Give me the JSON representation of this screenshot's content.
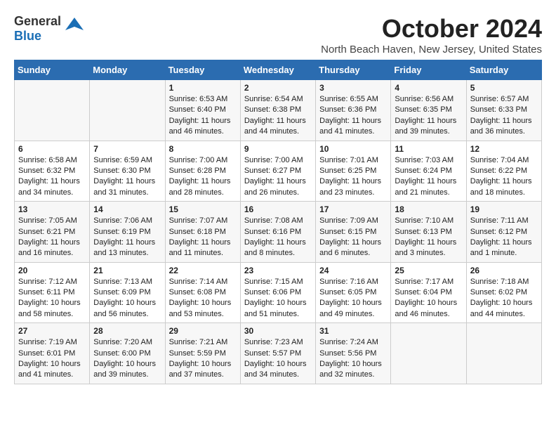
{
  "header": {
    "logo_general": "General",
    "logo_blue": "Blue",
    "month": "October 2024",
    "location": "North Beach Haven, New Jersey, United States"
  },
  "weekdays": [
    "Sunday",
    "Monday",
    "Tuesday",
    "Wednesday",
    "Thursday",
    "Friday",
    "Saturday"
  ],
  "weeks": [
    [
      {
        "day": "",
        "content": ""
      },
      {
        "day": "",
        "content": ""
      },
      {
        "day": "1",
        "content": "Sunrise: 6:53 AM\nSunset: 6:40 PM\nDaylight: 11 hours and 46 minutes."
      },
      {
        "day": "2",
        "content": "Sunrise: 6:54 AM\nSunset: 6:38 PM\nDaylight: 11 hours and 44 minutes."
      },
      {
        "day": "3",
        "content": "Sunrise: 6:55 AM\nSunset: 6:36 PM\nDaylight: 11 hours and 41 minutes."
      },
      {
        "day": "4",
        "content": "Sunrise: 6:56 AM\nSunset: 6:35 PM\nDaylight: 11 hours and 39 minutes."
      },
      {
        "day": "5",
        "content": "Sunrise: 6:57 AM\nSunset: 6:33 PM\nDaylight: 11 hours and 36 minutes."
      }
    ],
    [
      {
        "day": "6",
        "content": "Sunrise: 6:58 AM\nSunset: 6:32 PM\nDaylight: 11 hours and 34 minutes."
      },
      {
        "day": "7",
        "content": "Sunrise: 6:59 AM\nSunset: 6:30 PM\nDaylight: 11 hours and 31 minutes."
      },
      {
        "day": "8",
        "content": "Sunrise: 7:00 AM\nSunset: 6:28 PM\nDaylight: 11 hours and 28 minutes."
      },
      {
        "day": "9",
        "content": "Sunrise: 7:00 AM\nSunset: 6:27 PM\nDaylight: 11 hours and 26 minutes."
      },
      {
        "day": "10",
        "content": "Sunrise: 7:01 AM\nSunset: 6:25 PM\nDaylight: 11 hours and 23 minutes."
      },
      {
        "day": "11",
        "content": "Sunrise: 7:03 AM\nSunset: 6:24 PM\nDaylight: 11 hours and 21 minutes."
      },
      {
        "day": "12",
        "content": "Sunrise: 7:04 AM\nSunset: 6:22 PM\nDaylight: 11 hours and 18 minutes."
      }
    ],
    [
      {
        "day": "13",
        "content": "Sunrise: 7:05 AM\nSunset: 6:21 PM\nDaylight: 11 hours and 16 minutes."
      },
      {
        "day": "14",
        "content": "Sunrise: 7:06 AM\nSunset: 6:19 PM\nDaylight: 11 hours and 13 minutes."
      },
      {
        "day": "15",
        "content": "Sunrise: 7:07 AM\nSunset: 6:18 PM\nDaylight: 11 hours and 11 minutes."
      },
      {
        "day": "16",
        "content": "Sunrise: 7:08 AM\nSunset: 6:16 PM\nDaylight: 11 hours and 8 minutes."
      },
      {
        "day": "17",
        "content": "Sunrise: 7:09 AM\nSunset: 6:15 PM\nDaylight: 11 hours and 6 minutes."
      },
      {
        "day": "18",
        "content": "Sunrise: 7:10 AM\nSunset: 6:13 PM\nDaylight: 11 hours and 3 minutes."
      },
      {
        "day": "19",
        "content": "Sunrise: 7:11 AM\nSunset: 6:12 PM\nDaylight: 11 hours and 1 minute."
      }
    ],
    [
      {
        "day": "20",
        "content": "Sunrise: 7:12 AM\nSunset: 6:11 PM\nDaylight: 10 hours and 58 minutes."
      },
      {
        "day": "21",
        "content": "Sunrise: 7:13 AM\nSunset: 6:09 PM\nDaylight: 10 hours and 56 minutes."
      },
      {
        "day": "22",
        "content": "Sunrise: 7:14 AM\nSunset: 6:08 PM\nDaylight: 10 hours and 53 minutes."
      },
      {
        "day": "23",
        "content": "Sunrise: 7:15 AM\nSunset: 6:06 PM\nDaylight: 10 hours and 51 minutes."
      },
      {
        "day": "24",
        "content": "Sunrise: 7:16 AM\nSunset: 6:05 PM\nDaylight: 10 hours and 49 minutes."
      },
      {
        "day": "25",
        "content": "Sunrise: 7:17 AM\nSunset: 6:04 PM\nDaylight: 10 hours and 46 minutes."
      },
      {
        "day": "26",
        "content": "Sunrise: 7:18 AM\nSunset: 6:02 PM\nDaylight: 10 hours and 44 minutes."
      }
    ],
    [
      {
        "day": "27",
        "content": "Sunrise: 7:19 AM\nSunset: 6:01 PM\nDaylight: 10 hours and 41 minutes."
      },
      {
        "day": "28",
        "content": "Sunrise: 7:20 AM\nSunset: 6:00 PM\nDaylight: 10 hours and 39 minutes."
      },
      {
        "day": "29",
        "content": "Sunrise: 7:21 AM\nSunset: 5:59 PM\nDaylight: 10 hours and 37 minutes."
      },
      {
        "day": "30",
        "content": "Sunrise: 7:23 AM\nSunset: 5:57 PM\nDaylight: 10 hours and 34 minutes."
      },
      {
        "day": "31",
        "content": "Sunrise: 7:24 AM\nSunset: 5:56 PM\nDaylight: 10 hours and 32 minutes."
      },
      {
        "day": "",
        "content": ""
      },
      {
        "day": "",
        "content": ""
      }
    ]
  ]
}
